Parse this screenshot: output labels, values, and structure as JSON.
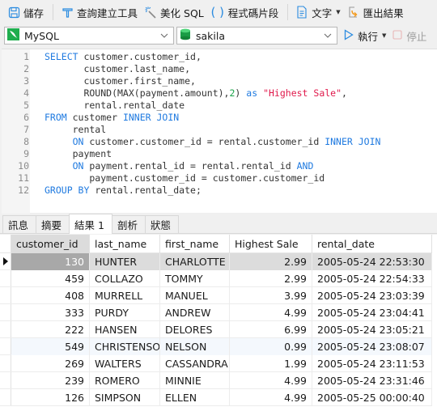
{
  "toolbar": {
    "save": "儲存",
    "query_builder": "查詢建立工具",
    "beautify_sql": "美化 SQL",
    "code_snippet": "程式碼片段",
    "text": "文字",
    "export_results": "匯出結果"
  },
  "connection": {
    "type": "MySQL",
    "database": "sakila",
    "run": "執行",
    "stop": "停止"
  },
  "editor": {
    "lines": [
      {
        "n": "1",
        "tokens": [
          {
            "t": "kw",
            "v": "SELECT"
          },
          {
            "t": "",
            "v": " customer.customer_id,"
          }
        ]
      },
      {
        "n": "2",
        "tokens": [
          {
            "t": "",
            "v": "       customer.last_name,"
          }
        ]
      },
      {
        "n": "3",
        "tokens": [
          {
            "t": "",
            "v": "       customer.first_name,"
          }
        ]
      },
      {
        "n": "4",
        "tokens": [
          {
            "t": "",
            "v": "       ROUND(MAX(payment.amount),"
          },
          {
            "t": "num",
            "v": "2"
          },
          {
            "t": "",
            "v": ") "
          },
          {
            "t": "kw",
            "v": "as"
          },
          {
            "t": "",
            "v": " "
          },
          {
            "t": "str",
            "v": "\"Highest Sale\""
          },
          {
            "t": "",
            "v": ","
          }
        ]
      },
      {
        "n": "5",
        "tokens": [
          {
            "t": "",
            "v": "       rental.rental_date"
          }
        ]
      },
      {
        "n": "6",
        "tokens": [
          {
            "t": "kw",
            "v": "FROM"
          },
          {
            "t": "",
            "v": " customer "
          },
          {
            "t": "kw",
            "v": "INNER JOIN"
          }
        ]
      },
      {
        "n": "7",
        "tokens": [
          {
            "t": "",
            "v": "     rental"
          }
        ]
      },
      {
        "n": "8",
        "tokens": [
          {
            "t": "",
            "v": "     "
          },
          {
            "t": "kw",
            "v": "ON"
          },
          {
            "t": "",
            "v": " customer.customer_id = rental.customer_id "
          },
          {
            "t": "kw",
            "v": "INNER JOIN"
          }
        ]
      },
      {
        "n": "9",
        "tokens": [
          {
            "t": "",
            "v": "     payment"
          }
        ]
      },
      {
        "n": "10",
        "tokens": [
          {
            "t": "",
            "v": "     "
          },
          {
            "t": "kw",
            "v": "ON"
          },
          {
            "t": "",
            "v": " payment.rental_id = rental.rental_id "
          },
          {
            "t": "kw",
            "v": "AND"
          }
        ]
      },
      {
        "n": "11",
        "tokens": [
          {
            "t": "",
            "v": "        payment.customer_id = customer.customer_id"
          }
        ]
      },
      {
        "n": "12",
        "tokens": [
          {
            "t": "kw",
            "v": "GROUP BY"
          },
          {
            "t": "",
            "v": " rental.rental_date;"
          }
        ]
      }
    ]
  },
  "tabs": [
    {
      "label": "訊息",
      "active": false
    },
    {
      "label": "摘要",
      "active": false
    },
    {
      "label": "結果 1",
      "active": true
    },
    {
      "label": "剖析",
      "active": false
    },
    {
      "label": "狀態",
      "active": false
    }
  ],
  "grid": {
    "columns": [
      "customer_id",
      "last_name",
      "first_name",
      "Highest Sale",
      "rental_date"
    ],
    "rows": [
      [
        "130",
        "HUNTER",
        "CHARLOTTE",
        "2.99",
        "2005-05-24 22:53:30"
      ],
      [
        "459",
        "COLLAZO",
        "TOMMY",
        "2.99",
        "2005-05-24 22:54:33"
      ],
      [
        "408",
        "MURRELL",
        "MANUEL",
        "3.99",
        "2005-05-24 23:03:39"
      ],
      [
        "333",
        "PURDY",
        "ANDREW",
        "4.99",
        "2005-05-24 23:04:41"
      ],
      [
        "222",
        "HANSEN",
        "DELORES",
        "6.99",
        "2005-05-24 23:05:21"
      ],
      [
        "549",
        "CHRISTENSO",
        "NELSON",
        "0.99",
        "2005-05-24 23:08:07"
      ],
      [
        "269",
        "WALTERS",
        "CASSANDRA",
        "1.99",
        "2005-05-24 23:11:53"
      ],
      [
        "239",
        "ROMERO",
        "MINNIE",
        "4.99",
        "2005-05-24 23:31:46"
      ],
      [
        "126",
        "SIMPSON",
        "ELLEN",
        "4.99",
        "2005-05-25 00:00:40"
      ]
    ],
    "current_row": 0,
    "highlight_row": 5
  }
}
